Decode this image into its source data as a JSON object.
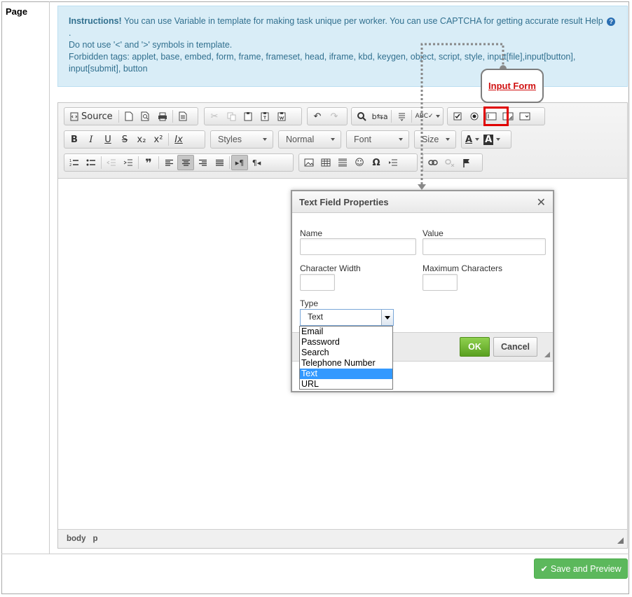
{
  "page": {
    "label": "Page"
  },
  "instructions": {
    "heading": "Instructions!",
    "line1": "You can use Variable in template for making task unique per worker. You can use CAPTCHA for getting accurate result Help",
    "help_icon": "question-circle-icon",
    "line2": ".",
    "line3": "Do not use '<' and '>' symbols in template.",
    "line4": "Forbidden tags: applet, base, embed, form, frame, frameset, head, iframe, kbd, keygen, object, script, style, input[file],input[button], input[submit], button"
  },
  "toolbar": {
    "source_label": "Source",
    "styles_label": "Styles",
    "format_label": "Normal",
    "font_label": "Font",
    "size_label": "Size",
    "bold": "B",
    "italic": "I",
    "underline": "U",
    "strike": "S",
    "subscript": "x₂",
    "superscript": "x²",
    "remove_format": "Ix"
  },
  "statusbar": {
    "items": [
      "body",
      "p"
    ]
  },
  "dialog": {
    "title": "Text Field Properties",
    "name_label": "Name",
    "value_label": "Value",
    "width_label": "Character Width",
    "maxchars_label": "Maximum Characters",
    "type_label": "Type",
    "type_value": "Text",
    "type_options": [
      "Email",
      "Password",
      "Search",
      "Telephone Number",
      "Text",
      "URL"
    ],
    "ok_label": "OK",
    "cancel_label": "Cancel"
  },
  "callout": {
    "label": "Input Form"
  },
  "actions": {
    "save_preview_label": "Save and Preview"
  },
  "colors": {
    "accent_green": "#5cb85c",
    "info_bg": "#d9edf7",
    "info_text": "#31708f",
    "highlight_red": "#e00000",
    "selection_blue": "#3399ff"
  }
}
